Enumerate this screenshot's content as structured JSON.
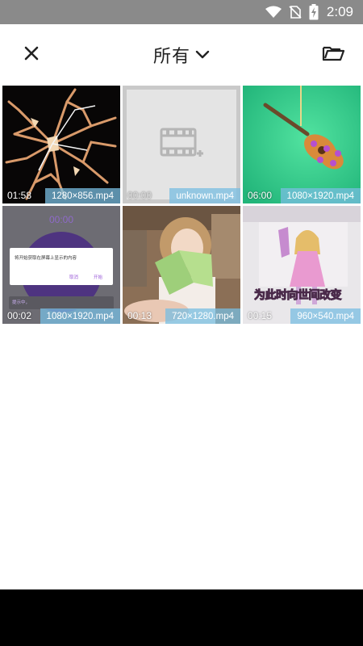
{
  "status_bar": {
    "time": "2:09",
    "icons": [
      "wifi-icon",
      "no-sim-icon",
      "battery-charging-icon"
    ]
  },
  "app_bar": {
    "close_icon": "close-icon",
    "title": "所有",
    "dropdown_icon": "chevron-down-icon",
    "folder_icon": "folder-icon"
  },
  "videos": [
    {
      "duration": "01:58",
      "resolution": "1280×856.mp4",
      "thumb": "shattered-glass"
    },
    {
      "duration": "00:00",
      "resolution": "unknown.mp4",
      "thumb": "placeholder"
    },
    {
      "duration": "06:00",
      "resolution": "1080×1920.mp4",
      "thumb": "guitar"
    },
    {
      "duration": "00:02",
      "resolution": "1080×1920.mp4",
      "thumb": "screen-recording",
      "thumb_text": {
        "timer": "00:00",
        "dialog": "将开始获取在屏幕上显示的内容",
        "cancel": "取消",
        "start": "开始",
        "footer": "提示中，"
      }
    },
    {
      "duration": "00:13",
      "resolution": "720×1280.mp4",
      "thumb": "reading-girl"
    },
    {
      "duration": "00:15",
      "resolution": "960×540.mp4",
      "thumb": "anime-character",
      "thumb_text": {
        "caption": "为此时向世间改变"
      }
    }
  ],
  "colors": {
    "status_bar": "#8a8a8a",
    "resolution_badge": "#78bee1",
    "nav_bar": "#000000"
  }
}
